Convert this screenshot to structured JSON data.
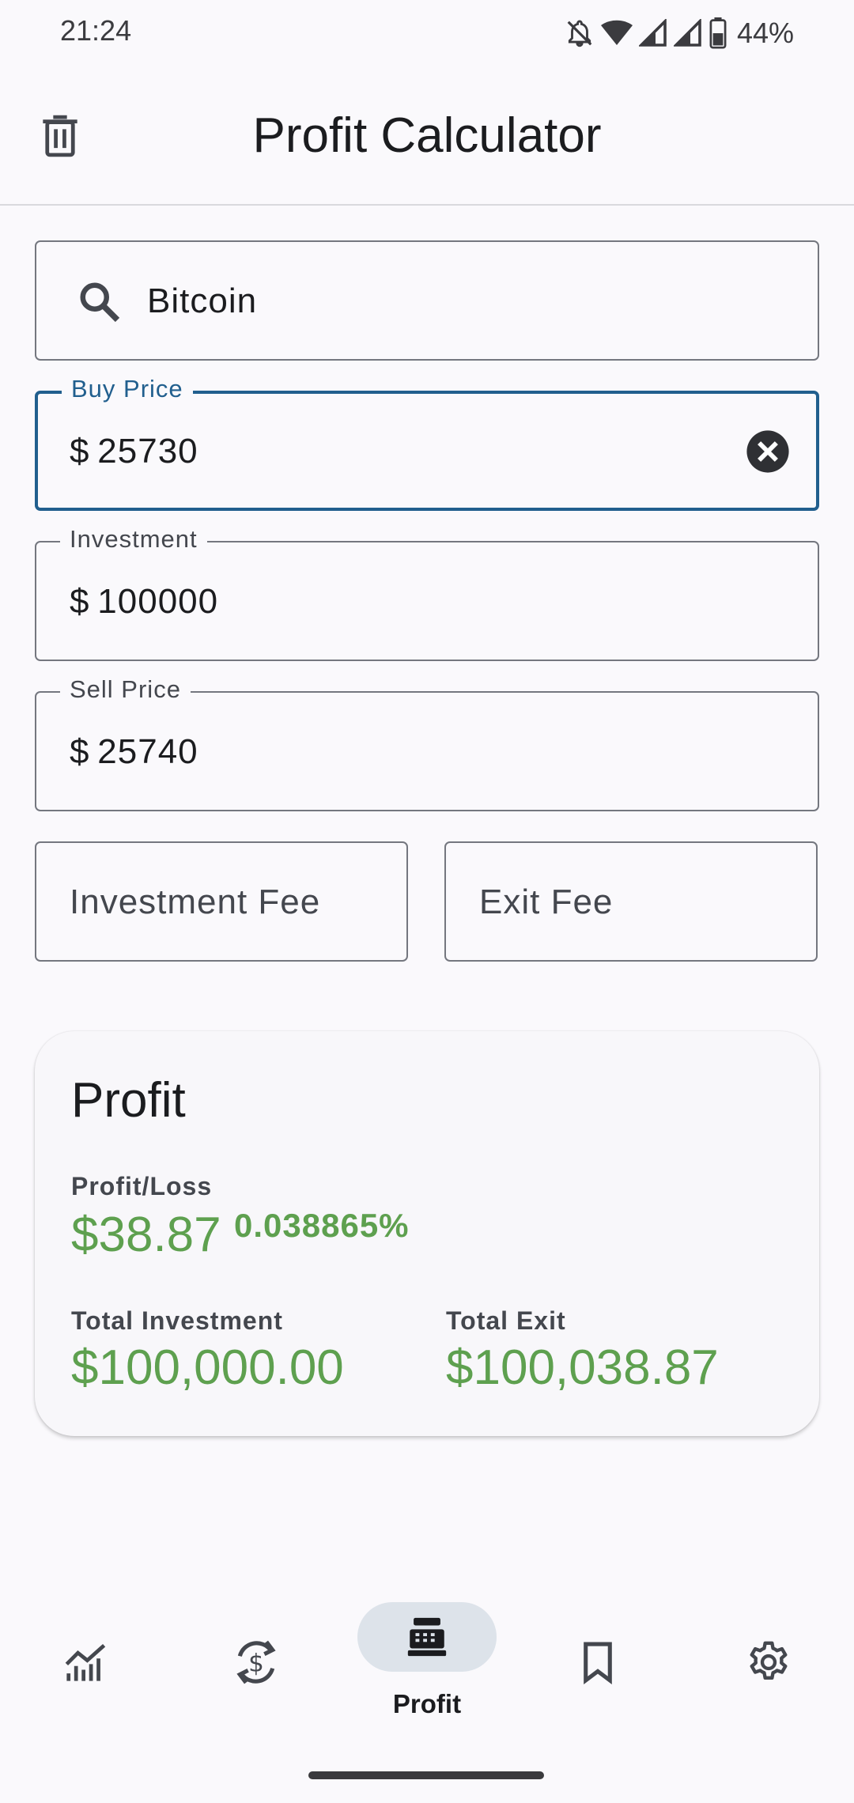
{
  "status_bar": {
    "time": "21:24",
    "battery_percent": "44%",
    "icons": [
      "bell-off-icon",
      "wifi-icon",
      "signal-icon",
      "signal-icon",
      "battery-icon"
    ]
  },
  "app_bar": {
    "title": "Profit Calculator",
    "left_icon": "trash-icon"
  },
  "search": {
    "value": "Bitcoin",
    "icon": "search-icon"
  },
  "buy_price": {
    "label": "Buy Price",
    "currency": "$",
    "value": "25730",
    "clear_icon": "clear-circle-icon"
  },
  "investment": {
    "label": "Investment",
    "currency": "$",
    "value": "100000"
  },
  "sell_price": {
    "label": "Sell Price",
    "currency": "$",
    "value": "25740"
  },
  "investment_fee": {
    "placeholder": "Investment Fee"
  },
  "exit_fee": {
    "placeholder": "Exit Fee"
  },
  "profit_card": {
    "title": "Profit",
    "profit_loss_label": "Profit/Loss",
    "profit_loss_value": "$38.87",
    "profit_loss_percent": "0.038865%",
    "total_investment_label": "Total Investment",
    "total_investment_value": "$100,000.00",
    "total_exit_label": "Total Exit",
    "total_exit_value": "$100,038.87"
  },
  "bottom_nav": {
    "items": [
      {
        "icon": "chart-icon",
        "label": ""
      },
      {
        "icon": "currency-exchange-icon",
        "label": ""
      },
      {
        "icon": "cash-register-icon",
        "label": "Profit",
        "active": true
      },
      {
        "icon": "bookmark-icon",
        "label": ""
      },
      {
        "icon": "settings-icon",
        "label": ""
      }
    ]
  },
  "colors": {
    "accent": "#215f8e",
    "positive": "#5ea04f",
    "background": "#faf9fc",
    "outline": "#74777f",
    "active_pill": "#dde3ea"
  }
}
